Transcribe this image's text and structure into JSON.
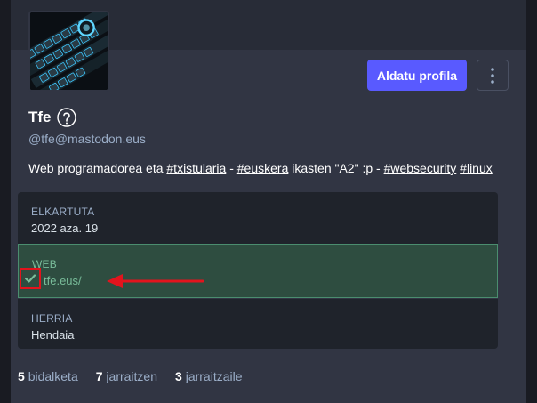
{
  "profile": {
    "display_name": "Tfe",
    "emoji_name": "ear-emoji",
    "handle": "@tfe@mastodon.eus",
    "edit_label": "Aldatu profila",
    "more_icon": "vertical-dots-icon",
    "bio": {
      "prefix": "Web programadorea eta ",
      "tag1": "#txistularia",
      "sep1": " - ",
      "tag2": "#euskera",
      "mid": " ikasten \"A2\" :p - ",
      "tag3": "#websecurity",
      "sep2": " ",
      "tag4": "#linux"
    }
  },
  "fields": [
    {
      "label": "ELKARTUTA",
      "value": "2022 aza. 19"
    },
    {
      "label": "WEB",
      "value": "tfe.eus/",
      "verified": true
    },
    {
      "label": "HERRIA",
      "value": "Hendaia"
    }
  ],
  "stats": {
    "posts_count": "5",
    "posts_label": "bidalketa",
    "following_count": "7",
    "following_label": "jarraitzen",
    "followers_count": "3",
    "followers_label": "jarraitzaile"
  },
  "colors": {
    "accent": "#595aff",
    "verified": "#79bd9a",
    "annotation": "#e2141d"
  }
}
